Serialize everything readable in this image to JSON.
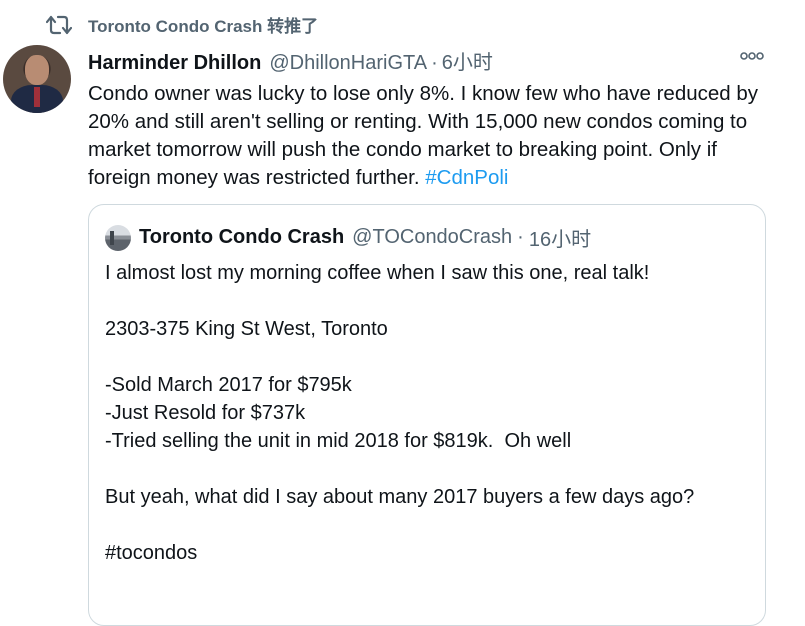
{
  "retweet": {
    "label": "Toronto Condo Crash 转推了"
  },
  "tweet": {
    "author_name": "Harminder Dhillon",
    "author_handle": "@DhillonHariGTA",
    "separator": "·",
    "time": "6小时",
    "text": "Condo owner was lucky to lose only 8%. I know few who have reduced by 20% and still aren't selling or renting. With 15,000 new condos coming to market tomorrow will push the condo market to breaking point. Only if foreign money was restricted further.",
    "hashtag": "#CdnPoli"
  },
  "quote": {
    "author_name": "Toronto Condo Crash",
    "author_handle": "@TOCondoCrash",
    "separator": "·",
    "time": "16小时",
    "lines": [
      "I almost lost my morning coffee when I saw this one, real talk!",
      "",
      "2303-375 King St West, Toronto",
      "",
      "-Sold March 2017 for $795k",
      "-Just Resold for $737k",
      "-Tried selling the unit in mid 2018 for $819k.  Oh well",
      "",
      "But yeah, what did I say about many 2017 buyers a few days ago?",
      "",
      "#tocondos"
    ]
  },
  "icons": {
    "retweet": "retweet-icon",
    "more": "more-icon"
  },
  "colors": {
    "link": "#1d9bf0",
    "secondary": "#536471",
    "border": "#cfd9de"
  }
}
